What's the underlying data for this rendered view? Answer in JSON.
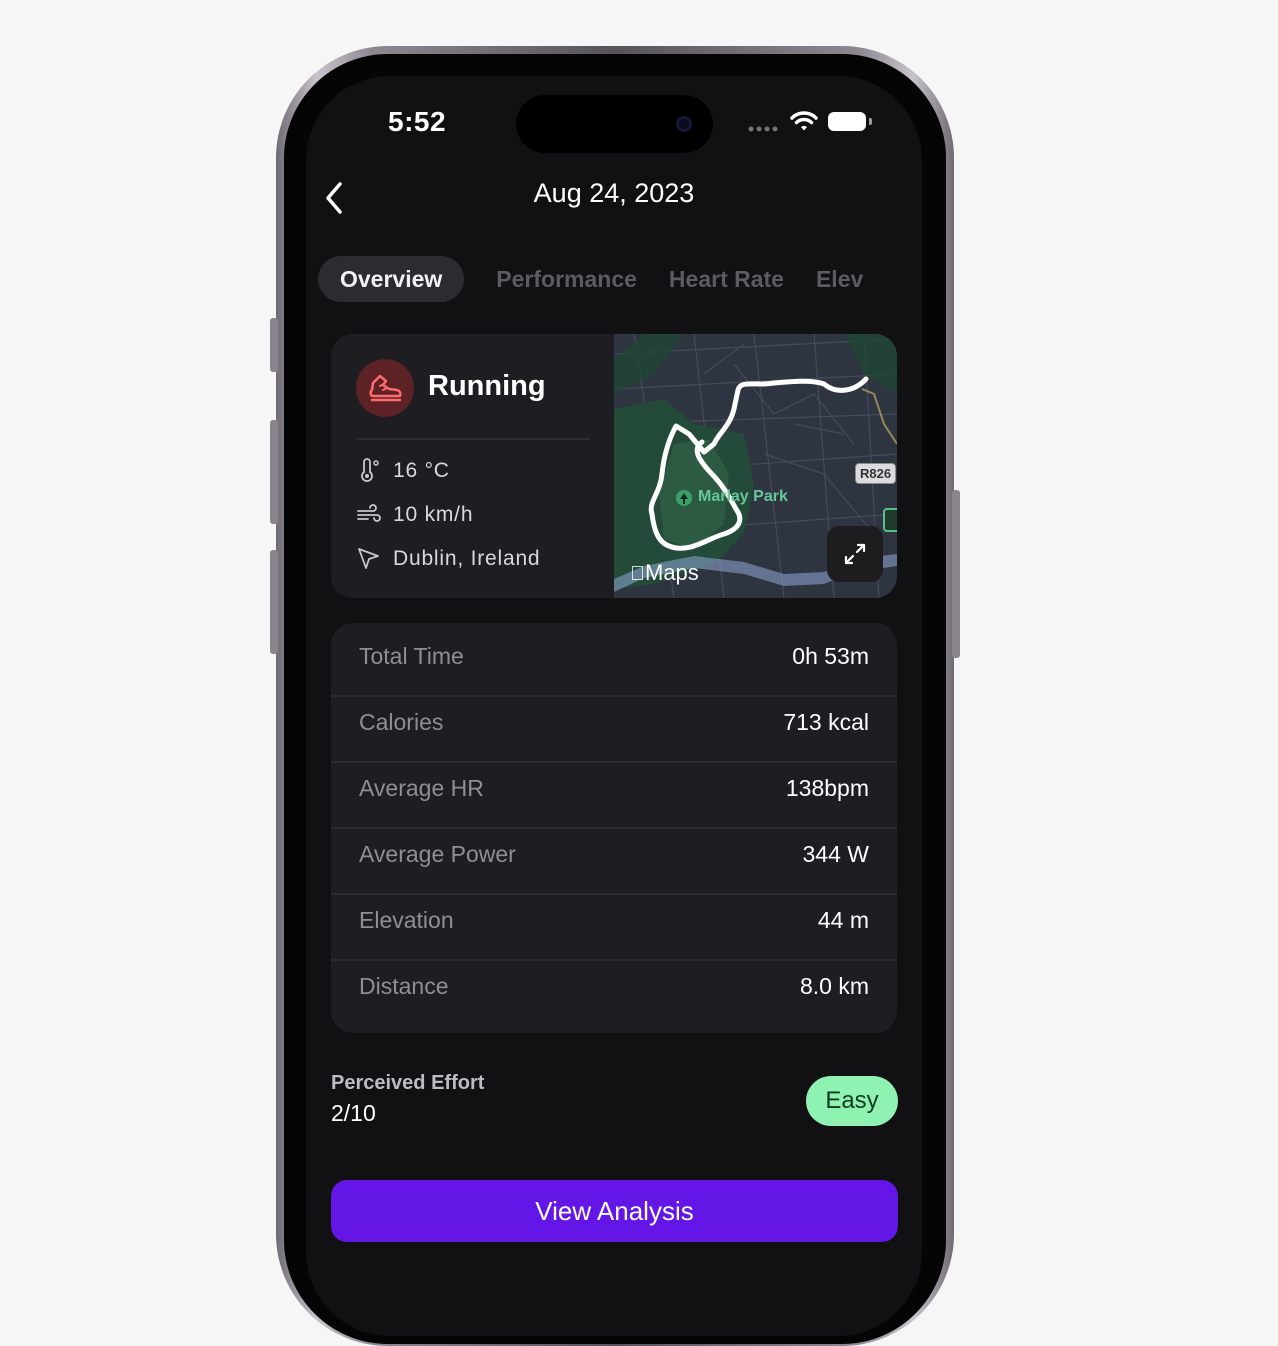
{
  "status_bar": {
    "time": "5:52"
  },
  "header": {
    "title": "Aug 24, 2023"
  },
  "tabs": [
    {
      "label": "Overview",
      "active": true
    },
    {
      "label": "Performance",
      "active": false
    },
    {
      "label": "Heart Rate",
      "active": false
    },
    {
      "label": "Elev",
      "active": false
    }
  ],
  "summary": {
    "sport": "Running",
    "temperature": "16 °C",
    "wind": "10 km/h",
    "location": "Dublin, Ireland",
    "map": {
      "park_label": "Marlay Park",
      "road_label": "R826",
      "brand_label": "Maps"
    }
  },
  "stats": [
    {
      "label": "Total Time",
      "value": "0h 53m"
    },
    {
      "label": "Calories",
      "value": "713 kcal"
    },
    {
      "label": "Average HR",
      "value": "138bpm"
    },
    {
      "label": "Average Power",
      "value": "344 W"
    },
    {
      "label": "Elevation",
      "value": "44 m"
    },
    {
      "label": "Distance",
      "value": "8.0 km"
    }
  ],
  "effort": {
    "label": "Perceived Effort",
    "value": "2/10",
    "badge": "Easy"
  },
  "cta": {
    "label": "View Analysis"
  },
  "colors": {
    "accent": "#6416e6",
    "badge_bg": "#8ff2b2",
    "sport_icon": "#ff6b6b"
  }
}
